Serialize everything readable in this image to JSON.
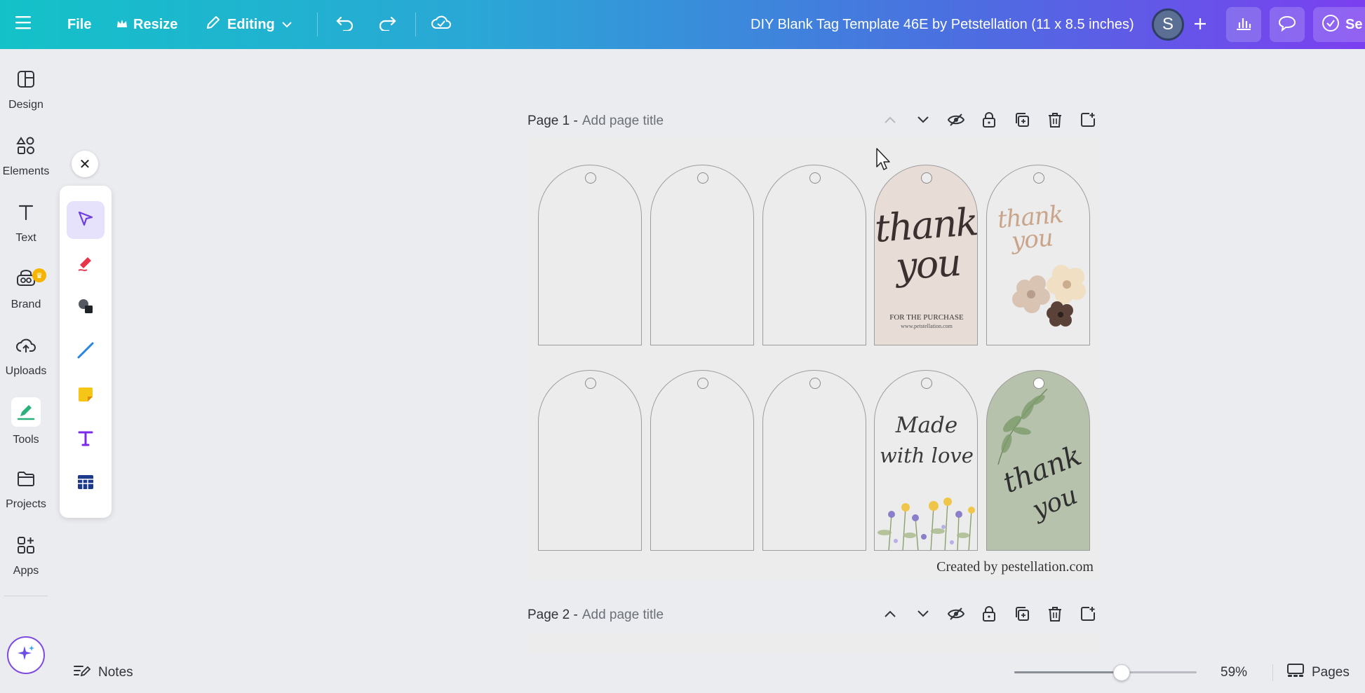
{
  "topbar": {
    "file_label": "File",
    "resize_label": "Resize",
    "mode_label": "Editing",
    "doc_title": "DIY Blank Tag Template 46E by Petstellation (11 x 8.5 inches)",
    "avatar_initial": "S",
    "share_label": "Se"
  },
  "rail": {
    "items": [
      {
        "label": "Design",
        "icon": "layout-icon"
      },
      {
        "label": "Elements",
        "icon": "shapes-icon"
      },
      {
        "label": "Text",
        "icon": "text-icon"
      },
      {
        "label": "Brand",
        "icon": "brand-icon"
      },
      {
        "label": "Uploads",
        "icon": "cloud-upload-icon"
      },
      {
        "label": "Tools",
        "icon": "pen-tool-icon"
      },
      {
        "label": "Projects",
        "icon": "folder-icon"
      },
      {
        "label": "Apps",
        "icon": "apps-grid-icon"
      }
    ]
  },
  "palette": {
    "tools": [
      "select-arrow",
      "marker-pen",
      "shapes",
      "line",
      "sticky-note",
      "text",
      "table"
    ],
    "selected": "select-arrow"
  },
  "pages": [
    {
      "label": "Page 1 -",
      "title_placeholder": "Add page title"
    },
    {
      "label": "Page 2 -",
      "title_placeholder": "Add page title"
    }
  ],
  "tags": {
    "row1_tag4_text_main": "thank you",
    "row1_tag4_sub": "FOR THE PURCHASE",
    "row1_tag4_url": "www.petstellation.com",
    "row1_tag5_text": "thank you",
    "row2_tag4_line1": "Made",
    "row2_tag4_line2": "with love",
    "row2_tag5_line1": "thank",
    "row2_tag5_line2": "you"
  },
  "credit": "Created by pestellation.com",
  "bottombar": {
    "notes_label": "Notes",
    "zoom_value": "59%",
    "zoom_fraction": 0.59,
    "pages_label": "Pages"
  },
  "colors": {
    "accent": "#7d2ae8",
    "pink_tag": "#e8dcd6",
    "sage_tag": "#b7c2ad"
  }
}
